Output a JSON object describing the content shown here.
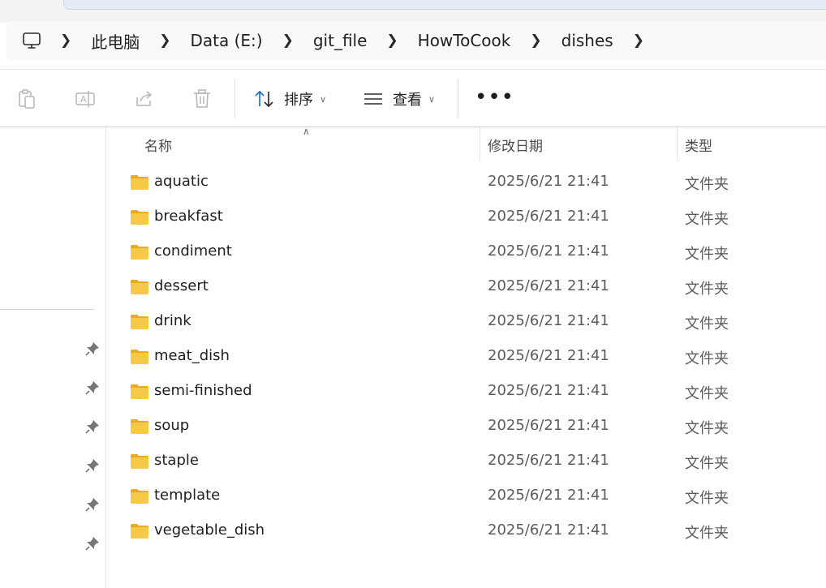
{
  "address": {
    "icon": "computer-icon",
    "crumbs": [
      "此电脑",
      "Data (E:)",
      "git_file",
      "HowToCook",
      "dishes"
    ]
  },
  "toolbar": {
    "sort_label": "排序",
    "view_label": "查看",
    "more_label": "•••"
  },
  "columns": {
    "name": "名称",
    "date": "修改日期",
    "type": "类型"
  },
  "files": [
    {
      "name": "aquatic",
      "date": "2025/6/21 21:41",
      "type": "文件夹"
    },
    {
      "name": "breakfast",
      "date": "2025/6/21 21:41",
      "type": "文件夹"
    },
    {
      "name": "condiment",
      "date": "2025/6/21 21:41",
      "type": "文件夹"
    },
    {
      "name": "dessert",
      "date": "2025/6/21 21:41",
      "type": "文件夹"
    },
    {
      "name": "drink",
      "date": "2025/6/21 21:41",
      "type": "文件夹"
    },
    {
      "name": "meat_dish",
      "date": "2025/6/21 21:41",
      "type": "文件夹"
    },
    {
      "name": "semi-finished",
      "date": "2025/6/21 21:41",
      "type": "文件夹"
    },
    {
      "name": "soup",
      "date": "2025/6/21 21:41",
      "type": "文件夹"
    },
    {
      "name": "staple",
      "date": "2025/6/21 21:41",
      "type": "文件夹"
    },
    {
      "name": "template",
      "date": "2025/6/21 21:41",
      "type": "文件夹"
    },
    {
      "name": "vegetable_dish",
      "date": "2025/6/21 21:41",
      "type": "文件夹"
    }
  ],
  "colors": {
    "folder": "#f7c948",
    "folder_dark": "#e8a923",
    "sort_arrow": "#1a73c8"
  }
}
